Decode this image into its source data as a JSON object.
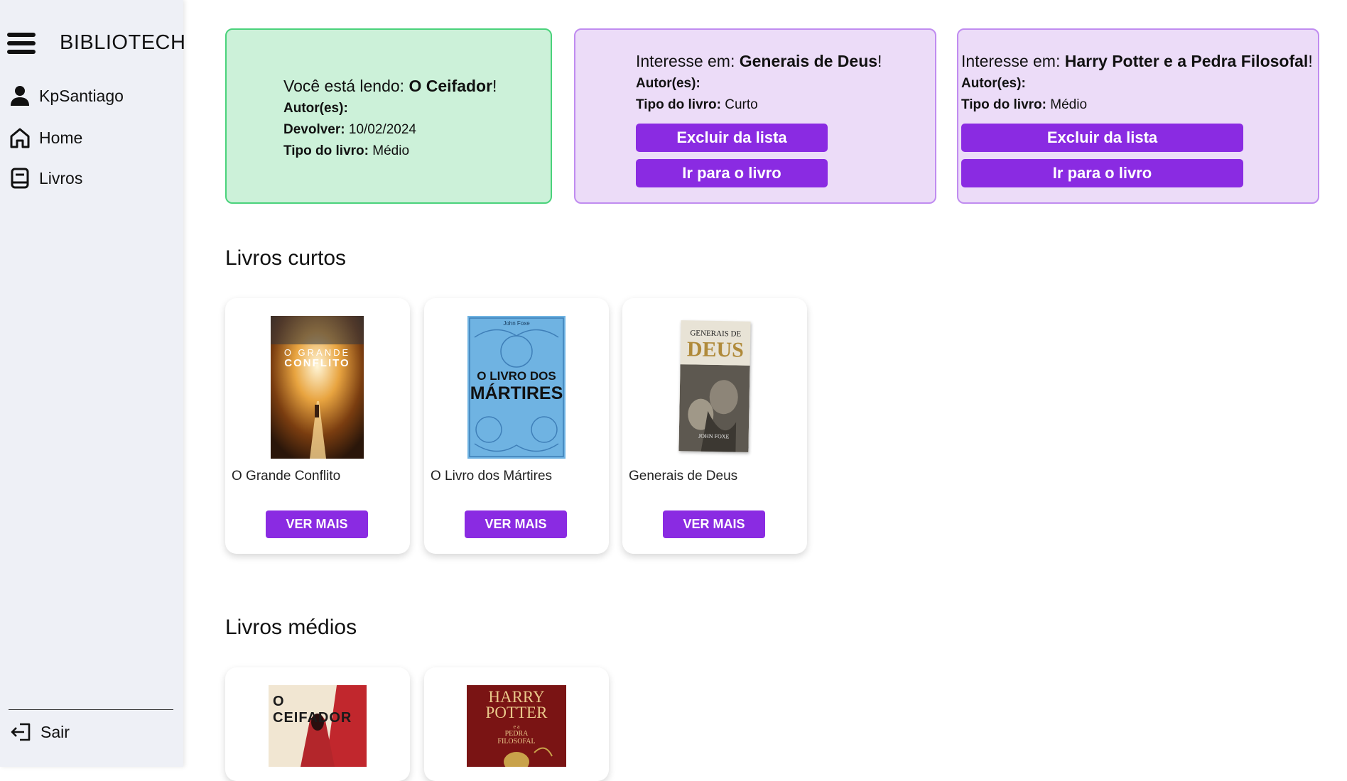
{
  "app": {
    "title": "BIBLIOTECH"
  },
  "sidebar": {
    "user": "KpSantiago",
    "items": [
      {
        "label": "Home",
        "icon": "home-icon"
      },
      {
        "label": "Livros",
        "icon": "book-icon"
      }
    ],
    "logout": "Sair"
  },
  "reading": {
    "prefix": "Você está lendo: ",
    "book": "O Ceifador",
    "suffix": "!",
    "author_label": "Autor(es):",
    "author_value": "",
    "return_label": "Devolver:",
    "return_date": "10/02/2024",
    "type_label": "Tipo do livro:",
    "type_value": "Médio"
  },
  "interests": [
    {
      "prefix": "Interesse em: ",
      "book": "Generais de Deus",
      "suffix": "!",
      "author_label": "Autor(es):",
      "author_value": "",
      "type_label": "Tipo do livro:",
      "type_value": "Curto",
      "remove_label": "Excluir da lista",
      "go_label": "Ir para o livro"
    },
    {
      "prefix": "Interesse em: ",
      "book": "Harry Potter e a Pedra Filosofal",
      "suffix": "!",
      "author_label": "Autor(es):",
      "author_value": "",
      "type_label": "Tipo do livro:",
      "type_value": "Médio",
      "remove_label": "Excluir da lista",
      "go_label": "Ir para o livro"
    }
  ],
  "sections": {
    "short": {
      "title": "Livros curtos",
      "books": [
        {
          "name": "O Grande Conflito",
          "button": "VER MAIS",
          "cover": {
            "line1": "O GRANDE",
            "line2": "CONFLITO"
          }
        },
        {
          "name": "O Livro dos Mártires",
          "button": "VER MAIS",
          "cover": {
            "author": "John Foxe",
            "line1": "O LIVRO DOS",
            "line2": "MÁRTIRES"
          }
        },
        {
          "name": "Generais de Deus",
          "button": "VER MAIS",
          "cover": {
            "line1": "GENERAIS DE",
            "line2": "DEUS",
            "author": "JOHN FOXE"
          }
        }
      ]
    },
    "medium": {
      "title": "Livros médios",
      "books": [
        {
          "cover": {
            "line1": "O CEIFADOR"
          }
        },
        {
          "cover": {
            "line1": "HARRY",
            "line2": "POTTER",
            "line3": "e a",
            "line4": "PEDRA",
            "line5": "FILOSOFAL"
          }
        }
      ]
    }
  },
  "colors": {
    "accent": "#8a2be2",
    "reading_bg": "#ccf1d9",
    "reading_border": "#4ad27b",
    "interest_bg": "#ecdcf8",
    "interest_border": "#c08cf0",
    "sidebar_bg": "#eef0f6"
  }
}
